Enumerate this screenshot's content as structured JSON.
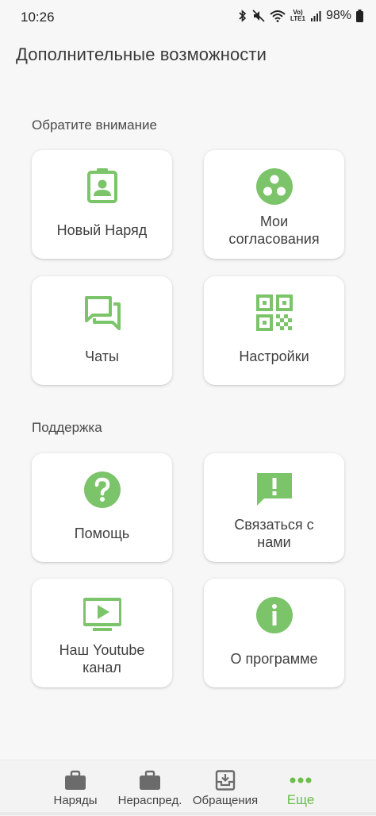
{
  "status_bar": {
    "time": "10:26",
    "battery": "98%",
    "lte_label": "LTE1"
  },
  "page_title": "Дополнительные возможности",
  "sections": {
    "attention": {
      "title": "Обратите внимание",
      "cards": [
        {
          "label": "Новый Наряд",
          "icon": "badge-icon"
        },
        {
          "label": "Мои\nсогласования",
          "icon": "approvals-icon"
        },
        {
          "label": "Чаты",
          "icon": "chat-icon"
        },
        {
          "label": "Настройки",
          "icon": "qr-code-icon"
        }
      ]
    },
    "support": {
      "title": "Поддержка",
      "cards": [
        {
          "label": "Помощь",
          "icon": "help-icon"
        },
        {
          "label": "Связаться с\nнами",
          "icon": "feedback-icon"
        },
        {
          "label": "Наш Youtube\nканал",
          "icon": "youtube-tv-icon"
        },
        {
          "label": "О программе",
          "icon": "info-icon"
        }
      ]
    }
  },
  "bottom_nav": {
    "items": [
      {
        "label": "Наряды",
        "icon": "briefcase-icon"
      },
      {
        "label": "Нераспред.",
        "icon": "briefcase-icon"
      },
      {
        "label": "Обращения",
        "icon": "archive-icon"
      },
      {
        "label": "Еще",
        "icon": "more-dots-icon",
        "active": true
      }
    ]
  },
  "colors": {
    "accent": "#6abf4b",
    "icon_green": "#7cc46a",
    "nav_icon": "#6b6b6b",
    "background": "#f7f7f7",
    "card": "#ffffff"
  }
}
